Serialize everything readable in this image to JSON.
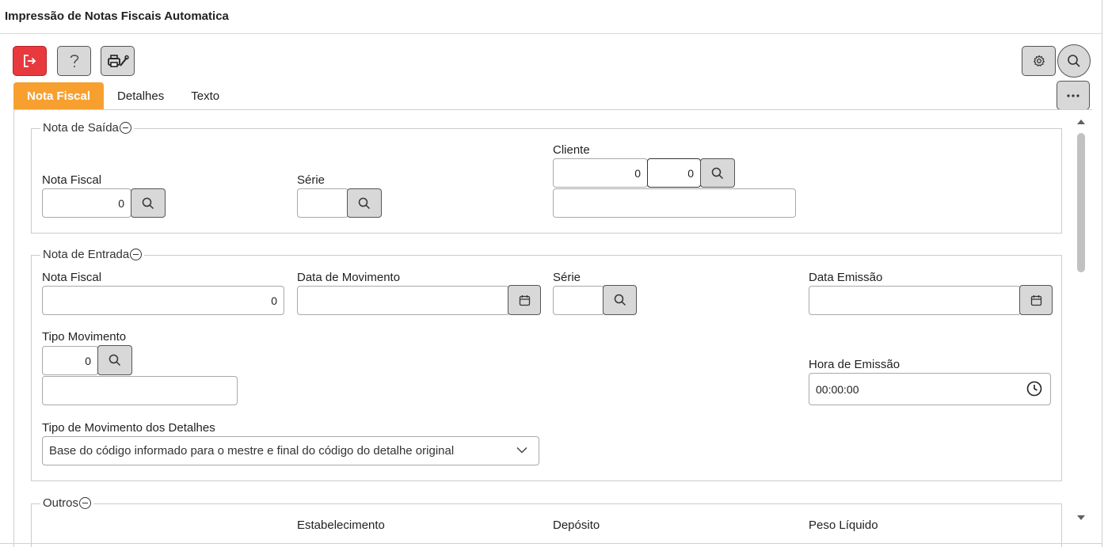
{
  "window": {
    "title": "Impressão de Notas Fiscais Automatica"
  },
  "toolbar": {
    "exit_icon": "exit-icon",
    "help_icon": "help-icon",
    "print_icon": "printer-icon",
    "settings_icon": "gear-icon",
    "search_icon": "search-icon",
    "more_icon": "more-icon",
    "exit_color": "#e8393f"
  },
  "tabs": [
    {
      "label": "Nota Fiscal",
      "active": true
    },
    {
      "label": "Detalhes",
      "active": false
    },
    {
      "label": "Texto",
      "active": false
    }
  ],
  "accent_color": "#f7a030",
  "nota_saida": {
    "legend": "Nota de Saída",
    "nota_fiscal": {
      "label": "Nota Fiscal",
      "value": "0"
    },
    "serie": {
      "label": "Série",
      "value": ""
    },
    "cliente": {
      "label": "Cliente",
      "value1": "0",
      "value2": "0",
      "description": ""
    }
  },
  "nota_entrada": {
    "legend": "Nota de Entrada",
    "nota_fiscal": {
      "label": "Nota Fiscal",
      "value": "0"
    },
    "data_movimento": {
      "label": "Data de Movimento",
      "value": ""
    },
    "serie": {
      "label": "Série",
      "value": ""
    },
    "data_emissao": {
      "label": "Data Emissão",
      "value": ""
    },
    "tipo_movimento": {
      "label": "Tipo Movimento",
      "value": "0",
      "description": ""
    },
    "hora_emissao": {
      "label": "Hora de Emissão",
      "value": "00:00:00"
    },
    "tipo_mov_detalhes": {
      "label": "Tipo de Movimento dos Detalhes",
      "selected": "Base do código informado para o mestre e final do código do detalhe original"
    }
  },
  "outros": {
    "legend": "Outros",
    "estabelecimento": {
      "label": "Estabelecimento"
    },
    "deposito": {
      "label": "Depósito"
    },
    "peso_liquido": {
      "label": "Peso Líquido"
    }
  }
}
